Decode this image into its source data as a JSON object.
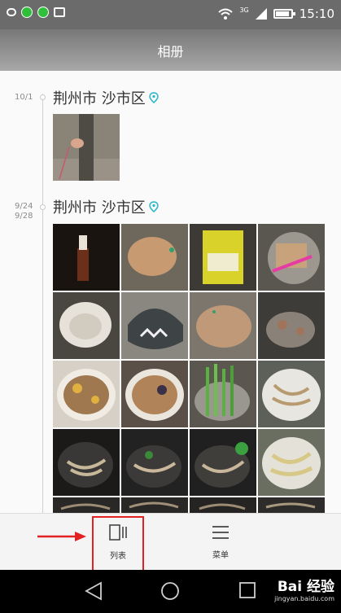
{
  "status_bar": {
    "time": "15:10",
    "network": "3G",
    "icons": [
      "chat-bubble-icon",
      "wechat-icon",
      "wechat-icon",
      "image-icon",
      "wifi-icon",
      "signal-icon",
      "battery-icon"
    ]
  },
  "header": {
    "title": "相册"
  },
  "groups": [
    {
      "dates": [
        "10/1"
      ],
      "location": "荆州市 沙市区",
      "photo_count": 1
    },
    {
      "dates": [
        "9/24",
        "9/28"
      ],
      "location": "荆州市 沙市区",
      "photo_count": 20
    }
  ],
  "toolbar": {
    "list_label": "列表",
    "menu_label": "菜单",
    "highlight_color": "#e22222"
  },
  "watermark": {
    "brand": "Bai 经验",
    "url": "jingyan.baidu.com"
  },
  "colors": {
    "status_bar": "#6b6b6b",
    "location_pin": "#29b6c8",
    "annotation": "#e22222"
  }
}
